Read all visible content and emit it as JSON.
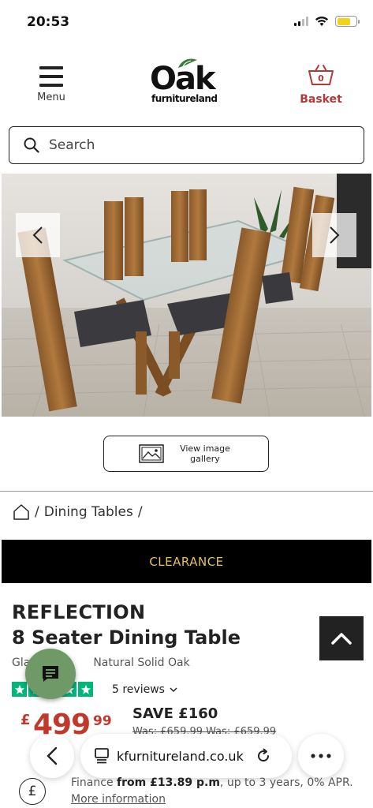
{
  "status_bar": {
    "time": "20:53"
  },
  "header": {
    "menu_label": "Menu",
    "logo_main": "Oak",
    "logo_sub": "furnitureland",
    "basket_label": "Basket",
    "basket_count": "0",
    "brand_color": "#b03a3a"
  },
  "search": {
    "placeholder": "Search"
  },
  "gallery": {
    "button_label": "View image gallery"
  },
  "breadcrumb": {
    "separator": "/",
    "items": [
      "Dining Tables"
    ],
    "trailing": "/"
  },
  "banner": {
    "label": "CLEARANCE",
    "text_color": "#e3c35a"
  },
  "product": {
    "brand": "REFLECTION",
    "name": "8 Seater Dining Table",
    "subtitle_start": "Gla",
    "subtitle_end": "Natural Solid Oak",
    "reviews": "5 reviews",
    "rating_stars": 5,
    "price_currency": "£",
    "price_main": "499",
    "price_pence": "99",
    "save": "SAVE £160",
    "was": "Was: £659.99 Was: £659.99"
  },
  "browser": {
    "url": "kfurnitureland.co.uk"
  },
  "finance": {
    "prefix": "Finance ",
    "amount": "from £13.89 p.m",
    "suffix": ", up to 3 years, 0% APR.",
    "link": "More information"
  }
}
